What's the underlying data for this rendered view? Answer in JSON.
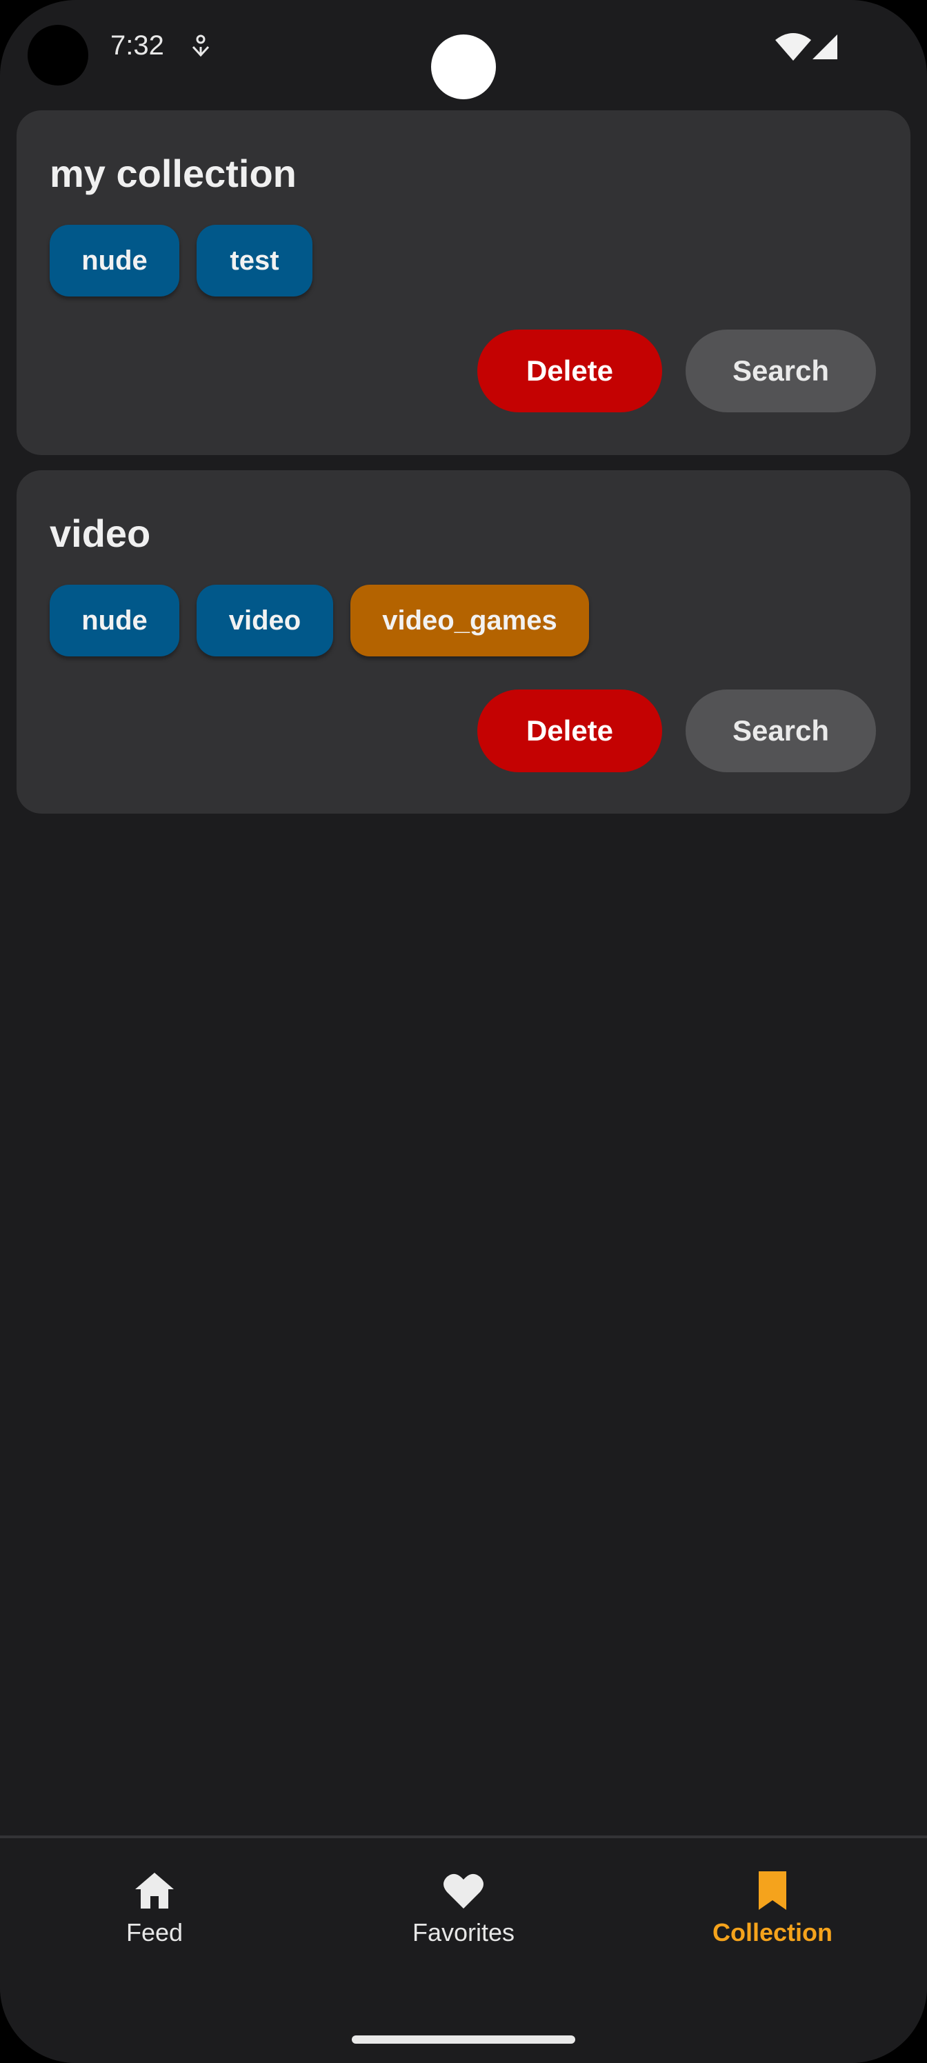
{
  "status_bar": {
    "time": "7:32"
  },
  "collections": [
    {
      "title": "my collection",
      "tags": [
        {
          "label": "nude",
          "color": "#01588a"
        },
        {
          "label": "test",
          "color": "#01588a"
        }
      ],
      "delete_label": "Delete",
      "search_label": "Search"
    },
    {
      "title": "video",
      "tags": [
        {
          "label": "nude",
          "color": "#01588a"
        },
        {
          "label": "video",
          "color": "#01588a"
        },
        {
          "label": "video_games",
          "color": "#b46300"
        }
      ],
      "delete_label": "Delete",
      "search_label": "Search"
    }
  ],
  "bottom_nav": {
    "items": [
      {
        "label": "Feed",
        "icon": "home-icon",
        "active": false
      },
      {
        "label": "Favorites",
        "icon": "heart-icon",
        "active": false
      },
      {
        "label": "Collection",
        "icon": "bookmark-icon",
        "active": true
      }
    ],
    "active_color": "#f5a31c"
  }
}
